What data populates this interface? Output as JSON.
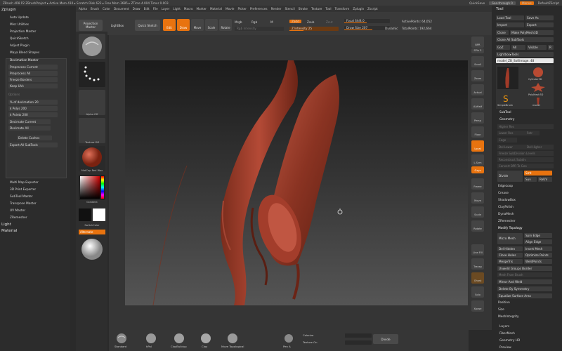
{
  "titlebar": {
    "left_text": "ZBrush 4R8 P2   ZBrushProject   ▸ Active Mem 410 ▸ Scratch Disk 622 ▸ Free Mem 3685 ▸ ZTime 4.004 Timer 0.003",
    "quicksave": "QuickSave",
    "see_through": "See-through  0",
    "menus": "Menus",
    "script": "DefaultZScript"
  },
  "menubar": [
    "Alpha",
    "Brush",
    "Color",
    "Document",
    "Draw",
    "Edit",
    "File",
    "Layer",
    "Light",
    "Macro",
    "Marker",
    "Material",
    "Movie",
    "Picker",
    "Preferences",
    "Render",
    "Stencil",
    "Stroke",
    "Texture",
    "Tool",
    "Transform",
    "Zplugin",
    "Zscript"
  ],
  "shelf": {
    "projection_master": "Projection Master",
    "lightbox": "LightBox",
    "quick_sketch": "Quick Sketch",
    "edit": "Edit",
    "draw": "Draw",
    "move": "Move",
    "scale": "Scale",
    "rotate": "Rotate",
    "mrgb": "Mrgb",
    "rgb": "Rgb",
    "m": "M",
    "zadd": "Zadd",
    "zsub": "Zsub",
    "zcut": "Zcut",
    "rgb_intensity": "Rgb Intensity",
    "z_intensity": "Z Intensity 25",
    "focal_shift": "Focal Shift 0",
    "draw_size": "Draw Size 207",
    "dynamic": "Dynamic",
    "active_points": "ActivePoints: 64,052",
    "total_points": "TotalPoints: 192,664"
  },
  "leftpanel": {
    "zplugin": "Zplugin",
    "items_top": [
      "Auto Update",
      "Misc Utilities",
      "Projection Master",
      "QuickSketch",
      "Adjust Plugin",
      "Maya Blend Shapes"
    ],
    "decimation_master": "Decimation Master",
    "preprocess_current": "Preprocess Current",
    "preprocess_all": "Preprocess All",
    "freeze_borders": "Freeze Borders",
    "keep_uvs": "Keep UVs",
    "options": "Options",
    "pct_decimation": "% of decimation 20",
    "k_polys": "k Polys 200",
    "k_points": "k Points 200",
    "decimate_current": "Decimate Current",
    "decimate_all": "Decimate All",
    "delete_caches": "Delete Caches",
    "export_all_subtools": "Export All SubTools",
    "items_bottom": [
      "Multi Map Exporter",
      "3D Print Exporter",
      "SubTool Master",
      "Transpose Master",
      "UV Master",
      "ZRemesher"
    ],
    "light": "Light",
    "material": "Material"
  },
  "thumbs": {
    "alpha_off": "Alpha Off",
    "texture_off": "Texture Off",
    "matcap": "MatCap Red Wax",
    "gradient": "Gradient",
    "switch_color": "SwitchColor",
    "alternate": "Alternate"
  },
  "rightrail": [
    "BPR",
    "SPix 3",
    "Scroll",
    "Zoom",
    "Actual",
    "AAHalf",
    "Persp",
    "Floor",
    "Local",
    "L.Sym",
    "Gxyz",
    "Frame",
    "Move",
    "Scale",
    "Rotate",
    "Line Fill",
    "Transp",
    "Ghost",
    "Solo",
    "Xpose"
  ],
  "toolpanel": {
    "title": "Tool",
    "load_tool": "Load Tool",
    "save_as": "Save As",
    "import": "Import",
    "export": "Export",
    "clone": "Clone",
    "make_polymesh": "Make PolyMesh3D",
    "clone_all_subtools": "Clone All SubTools",
    "goz": "GoZ",
    "all": "All",
    "visible": "Visible",
    "r": "R",
    "lightbox_tools": "Lightbox▸Tools",
    "model_name": "model_ZB_SoftImage. 48",
    "thumbs": [
      "Cylinder3D",
      "PolyMesh3D",
      "SimpleBrush",
      "model"
    ],
    "subtool": "SubTool",
    "geometry": "Geometry",
    "higher_res": "Higher Res",
    "lower_res": "Lower Res",
    "cage": "Cage",
    "rstr": "Rstr",
    "del_lower": "Del Lower",
    "del_higher": "Del Higher",
    "freeze_subdiv": "Freeze SubDivision Levels",
    "reconstruct_subdiv": "Reconstruct Subdiv",
    "convert_bpr": "Convert BPR To Geo",
    "divide": "Divide",
    "smt": "Smt",
    "suv": "Suv",
    "reuv": "ReUV",
    "items": [
      "EdgeLoop",
      "Crease",
      "ShadowBox",
      "ClayPolish",
      "DynaMesh",
      "ZRemesher"
    ],
    "modify_topology": "Modify Topology",
    "micro_mesh": "Micro Mesh",
    "spin_edge": "Spin Edge",
    "align_edge": "Align Edge",
    "del_hidden": "Del Hidden",
    "insert_mesh": "Insert Mesh",
    "close_holes": "Close Holes",
    "optimize_points": "Optimize Points",
    "mergetris": "MergeTris",
    "weldpoints": "WeldPoints",
    "unweld_groups": "Unweld Groups Border",
    "mesh_from_brush": "Mesh From Brush",
    "mirror_and_weld": "Mirror And Weld",
    "delete_by_symmetry": "Delete By Symmetry",
    "equalize_surface": "Equalize Surface Area",
    "position": "Position",
    "size": "Size",
    "meshintegrity": "MeshIntegrity",
    "layers": "Layers",
    "fibermesh": "FiberMesh",
    "geometry_hd": "Geometry HD",
    "preview": "Preview"
  },
  "bottombar": {
    "tools": [
      "Standard",
      "hPol",
      "ClayBuildup",
      "Clay",
      "Move Topological"
    ],
    "pen_a": "Pen A",
    "colorize": "Colorize",
    "texture_on": "Texture On",
    "divide": "Divide"
  }
}
